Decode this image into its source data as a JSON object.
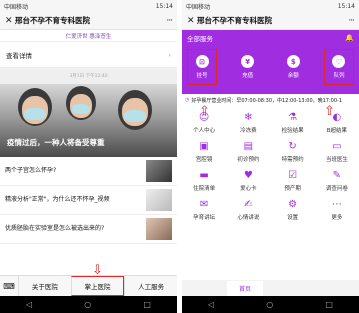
{
  "left": {
    "status": {
      "carrier": "中国移动",
      "time": "15:14"
    },
    "title": "邢台不孕不育专科医院",
    "doctor_line": "仁爱济世 惠泽苍生",
    "detail": {
      "label": "查看详情",
      "arrow": "›"
    },
    "timestamp": "3月1日 下午12:40",
    "banner_caption": "疫情过后，一种人将备受尊重",
    "articles": [
      {
        "title": "两个子宫怎么怀孕?"
      },
      {
        "title": "精液分析\"正常\"，为什么还不怀孕_视频"
      },
      {
        "title": "优质胚胎在实验室是怎么被选出来的?"
      }
    ],
    "menu": {
      "keyboard_icon": "⌨",
      "items": [
        "关于医院",
        "掌上医院",
        "人工服务"
      ]
    }
  },
  "right": {
    "status": {
      "carrier": "中国移动",
      "time": "15:14"
    },
    "title": "邢台不孕不育专科医院",
    "header": {
      "label": "全部服务",
      "bell_icon": "🔔"
    },
    "services": [
      {
        "icon": "register-icon",
        "glyph": "⊡",
        "label": "挂号"
      },
      {
        "icon": "recharge-icon",
        "glyph": "¥",
        "label": "充值"
      },
      {
        "icon": "balance-icon",
        "glyph": "$",
        "label": "余额"
      },
      {
        "icon": "queue-icon",
        "glyph": "♡",
        "label": "队列"
      }
    ],
    "hours": "好孕餐厅营业时间：早07:00-08:30，中12:00-13:00，晚17:00-1",
    "grid": [
      {
        "icon": "person-icon",
        "glyph": "☺",
        "label": "个人中心"
      },
      {
        "icon": "snowflake-icon",
        "glyph": "❄",
        "label": "冷冻费"
      },
      {
        "icon": "flask-icon",
        "glyph": "⚗",
        "label": "检验结果"
      },
      {
        "icon": "ultrasound-icon",
        "glyph": "◐",
        "label": "B超结果"
      },
      {
        "icon": "box-icon",
        "glyph": "▣",
        "label": "宫腔镜"
      },
      {
        "icon": "calendar-icon",
        "glyph": "▤",
        "label": "初诊预约"
      },
      {
        "icon": "refresh-icon",
        "glyph": "↻",
        "label": "特需预约"
      },
      {
        "icon": "document-icon",
        "glyph": "▭",
        "label": "当班医生"
      },
      {
        "icon": "bed-icon",
        "glyph": "▬",
        "label": "住院清单"
      },
      {
        "icon": "heart-card-icon",
        "glyph": "♥",
        "label": "爱心卡"
      },
      {
        "icon": "checklist-icon",
        "glyph": "☑",
        "label": "预产期"
      },
      {
        "icon": "survey-icon",
        "glyph": "✎",
        "label": "调查问卷"
      },
      {
        "icon": "chat-icon",
        "glyph": "✉",
        "label": "孕育讲坛"
      },
      {
        "icon": "diary-icon",
        "glyph": "✍",
        "label": "心情讲说"
      },
      {
        "icon": "gear-icon",
        "glyph": "⚙",
        "label": "设置"
      },
      {
        "icon": "more-icon",
        "glyph": "⋯",
        "label": "更多"
      }
    ],
    "bottom_tab": "首页"
  },
  "colors": {
    "brand_purple": "#a02ee0",
    "highlight_red": "#e12828"
  }
}
